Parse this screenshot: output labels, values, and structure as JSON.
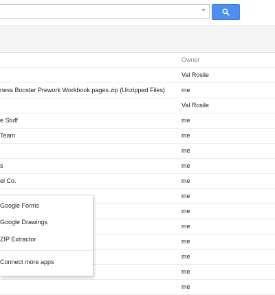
{
  "search": {
    "placeholder": ""
  },
  "table": {
    "owner_header": "Owner",
    "rows": [
      {
        "name": "",
        "owner": "Val Rosile"
      },
      {
        "name": "ness Booster Prework Workbook.pages.zip (Unzipped Files)",
        "owner": "me"
      },
      {
        "name": "",
        "owner": "Val Rosile"
      },
      {
        "name": "e Stuff",
        "owner": "me"
      },
      {
        "name": "Team",
        "owner": "me"
      },
      {
        "name": "",
        "owner": "me"
      },
      {
        "name": "s",
        "owner": "me"
      },
      {
        "name": "el Co.",
        "owner": "me"
      },
      {
        "name": "",
        "owner": "me"
      },
      {
        "name": "",
        "owner": "me"
      },
      {
        "name": "",
        "owner": "me"
      },
      {
        "name": "",
        "owner": "me"
      },
      {
        "name": "",
        "owner": "me"
      },
      {
        "name": "",
        "owner": "me"
      },
      {
        "name": "",
        "owner": "me"
      }
    ]
  },
  "menu": {
    "items": [
      "Google Forms",
      "Google Drawings",
      "ZIP Extractor"
    ],
    "connect_label": "Connect more apps"
  },
  "colors": {
    "search_button": "#4d8ff0",
    "toolbar_bg": "#f5f5f5"
  }
}
